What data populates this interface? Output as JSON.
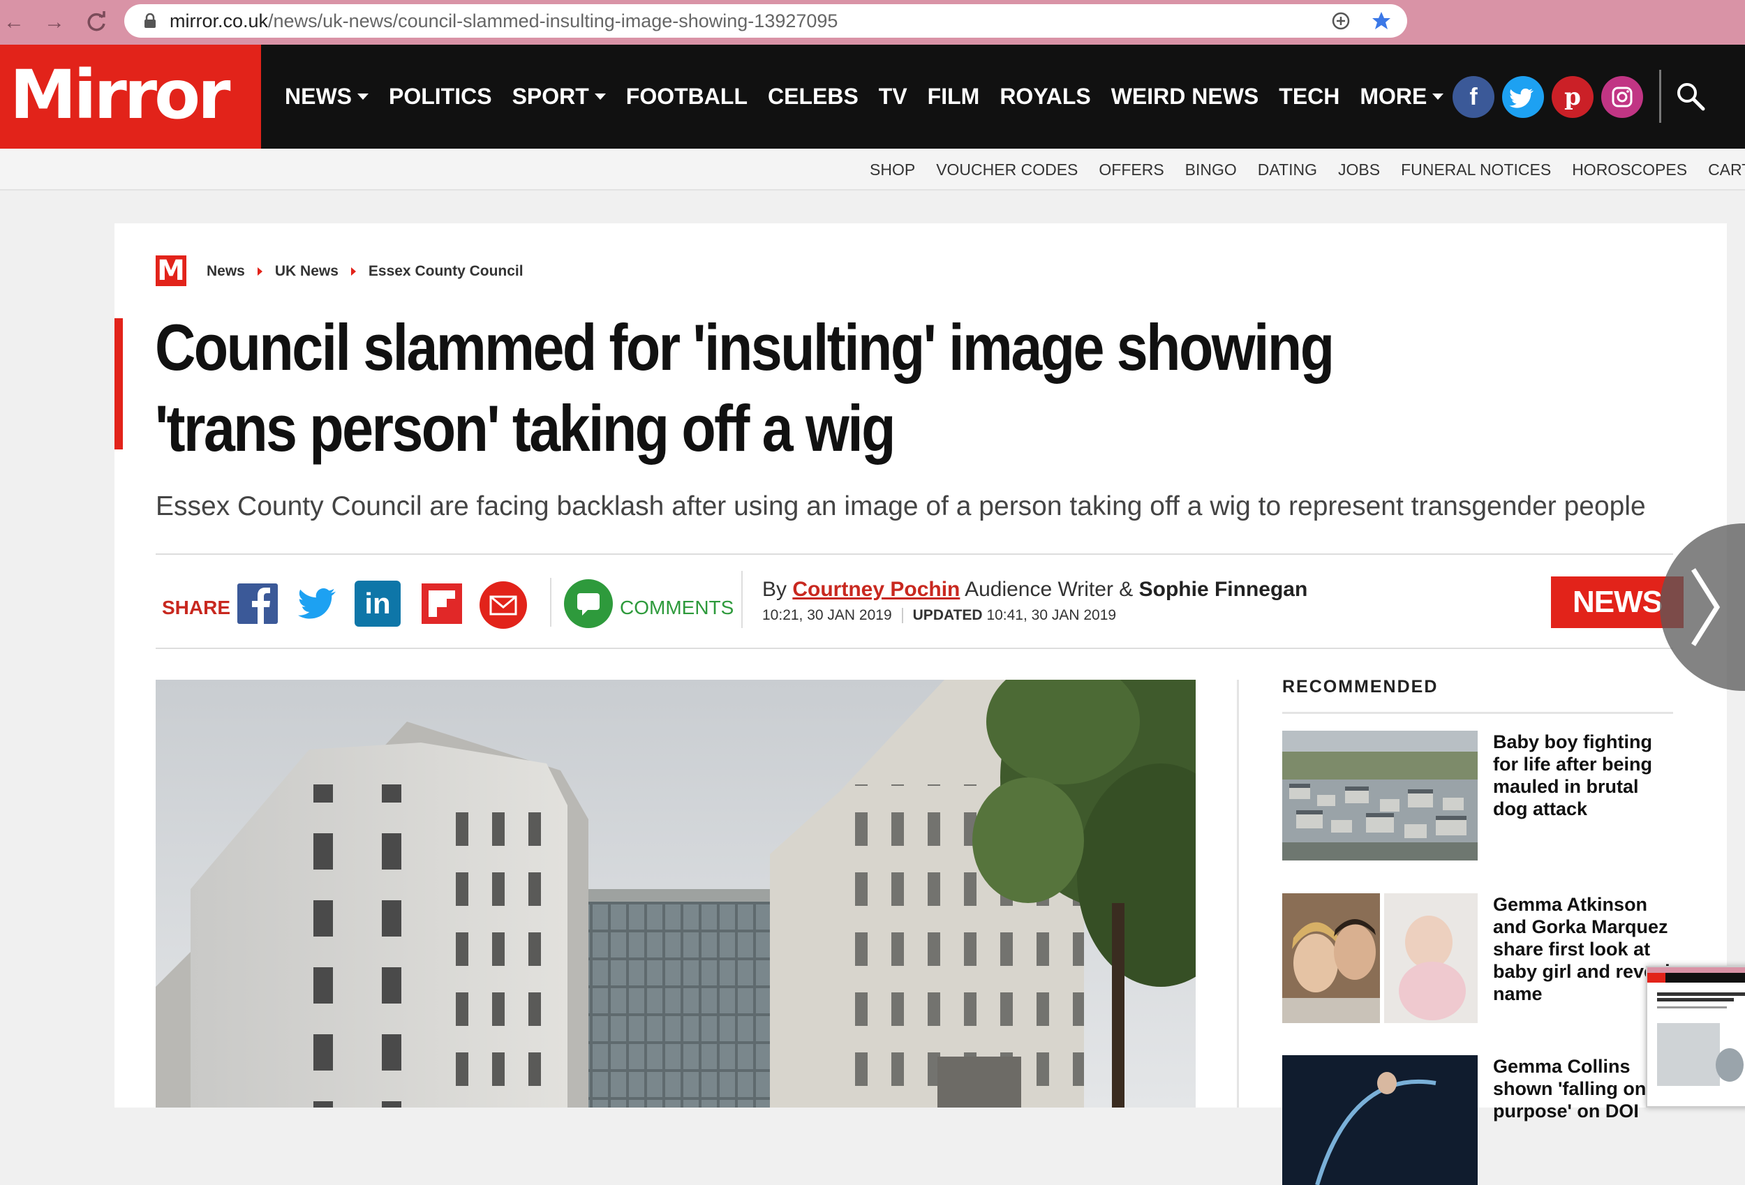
{
  "browser": {
    "url_domain": "mirror.co.uk",
    "url_path": "/news/uk-news/council-slammed-insulting-image-showing-13927095"
  },
  "site": {
    "logo_text": "Mirror",
    "main_nav": [
      "NEWS",
      "POLITICS",
      "SPORT",
      "FOOTBALL",
      "CELEBS",
      "TV",
      "FILM",
      "ROYALS",
      "WEIRD NEWS",
      "TECH",
      "MORE"
    ],
    "sub_nav": [
      "SHOP",
      "VOUCHER CODES",
      "OFFERS",
      "BINGO",
      "DATING",
      "JOBS",
      "FUNERAL NOTICES",
      "HOROSCOPES",
      "CARTOONS"
    ],
    "social_icons": [
      "facebook-icon",
      "twitter-icon",
      "pinterest-icon",
      "instagram-icon"
    ]
  },
  "article": {
    "breadcrumb": [
      "News",
      "UK News",
      "Essex County Council"
    ],
    "m_logo": "M",
    "headline": "Council slammed for 'insulting' image showing 'trans person' taking off a wig",
    "standfirst": "Essex County Council are facing backlash after using an image of a person taking off a wig to represent transgender people",
    "share_label": "SHARE",
    "comments_label": "COMMENTS",
    "byline_prefix": "By",
    "author1": "Courtney Pochin",
    "author1_role": "Audience Writer &",
    "author2": "Sophie Finnegan",
    "published": "10:21, 30 JAN 2019",
    "updated_label": "UPDATED",
    "updated": "10:41, 30 JAN 2019",
    "section_tag": "NEWS"
  },
  "recommended": {
    "title": "RECOMMENDED",
    "items": [
      {
        "headline": "Baby boy fighting for life after being mauled in brutal dog attack"
      },
      {
        "headline": "Gemma Atkinson and Gorka Marquez share first look at baby girl and reveal name"
      },
      {
        "headline": "Gemma Collins shown 'falling on purpose' on DOI"
      }
    ]
  },
  "colors": {
    "brand_red": "#e2231a",
    "chrome_pink": "#d993a6",
    "header_black": "#111111",
    "facebook": "#3b5998",
    "twitter": "#1da1f2",
    "pinterest": "#cb2027",
    "instagram": "#c13584",
    "linkedin": "#0e76a8",
    "comments_green": "#2e9a3c"
  }
}
